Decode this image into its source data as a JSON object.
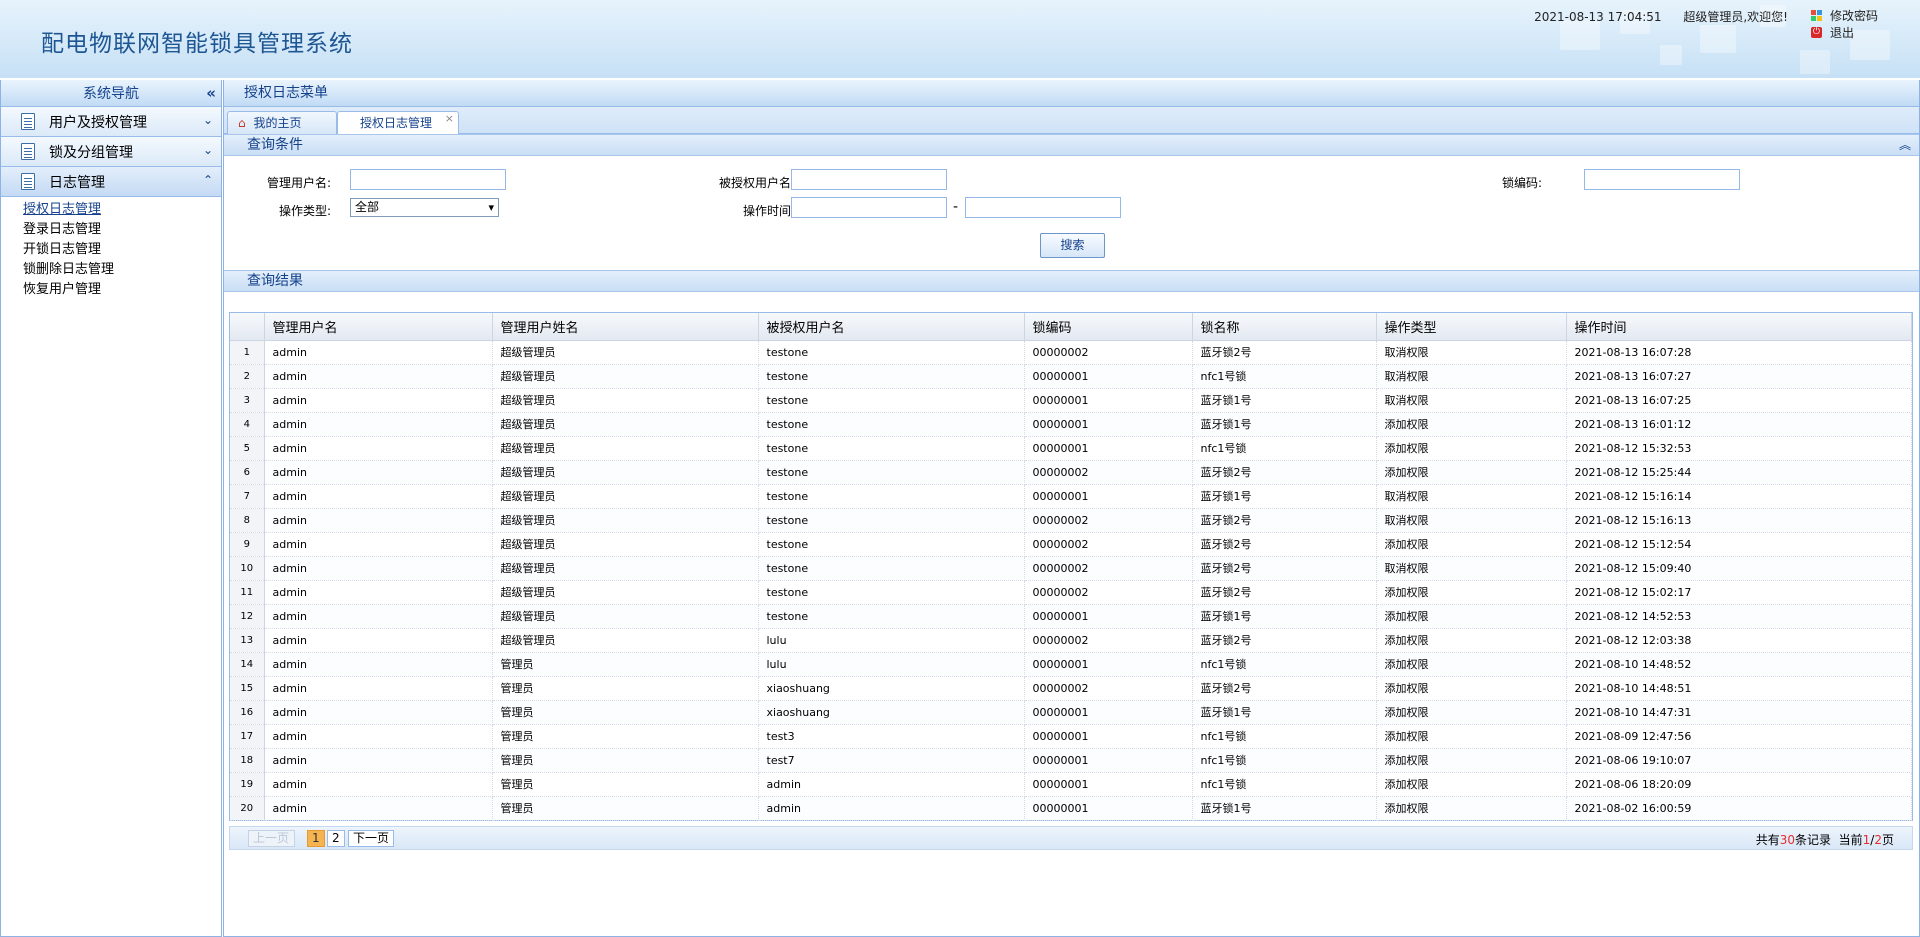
{
  "header": {
    "title": "配电物联网智能锁具管理系统",
    "datetime": "2021-08-13 17:04:51",
    "welcome": "超级管理员,欢迎您!",
    "change_password": "修改密码",
    "logout": "退出"
  },
  "sidebar": {
    "title": "系统导航",
    "collapse_icon": "«",
    "groups": [
      {
        "label": "用户及授权管理"
      },
      {
        "label": "锁及分组管理"
      },
      {
        "label": "日志管理"
      }
    ],
    "log_items": [
      "授权日志管理",
      "登录日志管理",
      "开锁日志管理",
      "锁删除日志管理",
      "恢复用户管理"
    ]
  },
  "main": {
    "title": "授权日志菜单",
    "tabs": [
      {
        "label": "我的主页"
      },
      {
        "label": "授权日志管理"
      }
    ],
    "query_title": "查询条件",
    "results_title": "查询结果"
  },
  "form": {
    "admin_user_label": "管理用户名:",
    "authorized_user_label": "被授权用户名:",
    "lock_code_label": "锁编码:",
    "op_type_label": "操作类型:",
    "op_type_value": "全部",
    "op_time_label": "操作时间:",
    "range_sep": "-",
    "search_label": "搜索"
  },
  "table": {
    "columns": [
      "管理用户名",
      "管理用户姓名",
      "被授权用户名",
      "锁编码",
      "锁名称",
      "操作类型",
      "操作时间"
    ],
    "rows": [
      [
        "1",
        "admin",
        "超级管理员",
        "testone",
        "00000002",
        "蓝牙锁2号",
        "取消权限",
        "2021-08-13 16:07:28"
      ],
      [
        "2",
        "admin",
        "超级管理员",
        "testone",
        "00000001",
        "nfc1号锁",
        "取消权限",
        "2021-08-13 16:07:27"
      ],
      [
        "3",
        "admin",
        "超级管理员",
        "testone",
        "00000001",
        "蓝牙锁1号",
        "取消权限",
        "2021-08-13 16:07:25"
      ],
      [
        "4",
        "admin",
        "超级管理员",
        "testone",
        "00000001",
        "蓝牙锁1号",
        "添加权限",
        "2021-08-13 16:01:12"
      ],
      [
        "5",
        "admin",
        "超级管理员",
        "testone",
        "00000001",
        "nfc1号锁",
        "添加权限",
        "2021-08-12 15:32:53"
      ],
      [
        "6",
        "admin",
        "超级管理员",
        "testone",
        "00000002",
        "蓝牙锁2号",
        "添加权限",
        "2021-08-12 15:25:44"
      ],
      [
        "7",
        "admin",
        "超级管理员",
        "testone",
        "00000001",
        "蓝牙锁1号",
        "取消权限",
        "2021-08-12 15:16:14"
      ],
      [
        "8",
        "admin",
        "超级管理员",
        "testone",
        "00000002",
        "蓝牙锁2号",
        "取消权限",
        "2021-08-12 15:16:13"
      ],
      [
        "9",
        "admin",
        "超级管理员",
        "testone",
        "00000002",
        "蓝牙锁2号",
        "添加权限",
        "2021-08-12 15:12:54"
      ],
      [
        "10",
        "admin",
        "超级管理员",
        "testone",
        "00000002",
        "蓝牙锁2号",
        "取消权限",
        "2021-08-12 15:09:40"
      ],
      [
        "11",
        "admin",
        "超级管理员",
        "testone",
        "00000002",
        "蓝牙锁2号",
        "添加权限",
        "2021-08-12 15:02:17"
      ],
      [
        "12",
        "admin",
        "超级管理员",
        "testone",
        "00000001",
        "蓝牙锁1号",
        "添加权限",
        "2021-08-12 14:52:53"
      ],
      [
        "13",
        "admin",
        "超级管理员",
        "lulu",
        "00000002",
        "蓝牙锁2号",
        "添加权限",
        "2021-08-12 12:03:38"
      ],
      [
        "14",
        "admin",
        "管理员",
        "lulu",
        "00000001",
        "nfc1号锁",
        "添加权限",
        "2021-08-10 14:48:52"
      ],
      [
        "15",
        "admin",
        "管理员",
        "xiaoshuang",
        "00000002",
        "蓝牙锁2号",
        "添加权限",
        "2021-08-10 14:48:51"
      ],
      [
        "16",
        "admin",
        "管理员",
        "xiaoshuang",
        "00000001",
        "蓝牙锁1号",
        "添加权限",
        "2021-08-10 14:47:31"
      ],
      [
        "17",
        "admin",
        "管理员",
        "test3",
        "00000001",
        "nfc1号锁",
        "添加权限",
        "2021-08-09 12:47:56"
      ],
      [
        "18",
        "admin",
        "管理员",
        "test7",
        "00000001",
        "nfc1号锁",
        "添加权限",
        "2021-08-06 19:10:07"
      ],
      [
        "19",
        "admin",
        "管理员",
        "admin",
        "00000001",
        "nfc1号锁",
        "添加权限",
        "2021-08-06 18:20:09"
      ],
      [
        "20",
        "admin",
        "管理员",
        "admin",
        "00000001",
        "蓝牙锁1号",
        "添加权限",
        "2021-08-02 16:00:59"
      ]
    ]
  },
  "pager": {
    "prev": "上一页",
    "pages": [
      "1",
      "2"
    ],
    "current": "1",
    "next": "下一页",
    "total_prefix": "共有",
    "total_count": "30",
    "total_suffix": "条记录",
    "current_prefix": "当前",
    "current_page": "1",
    "page_sep": "/",
    "total_pages": "2",
    "page_suffix": "页"
  },
  "colors": {
    "accent": "#15428b",
    "header_bg": "#d3e8f8",
    "highlight": "#e62c2c",
    "current_page": "#f5b44f"
  }
}
